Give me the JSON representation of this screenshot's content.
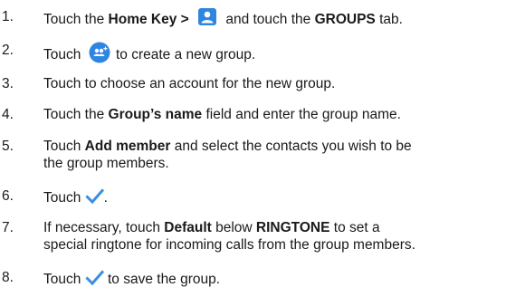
{
  "steps": [
    {
      "num": "1.",
      "t1": "Touch the ",
      "b1": "Home Key > ",
      "t2": " and touch the ",
      "b2": "GROUPS",
      "t3": " tab."
    },
    {
      "num": "2.",
      "t1": "Touch ",
      "t2": " to create a new group."
    },
    {
      "num": "3.",
      "t1": "Touch to choose an account for the new group."
    },
    {
      "num": "4.",
      "t1": "Touch the ",
      "b1": "Group’s name",
      "t2": " field and enter the group name."
    },
    {
      "num": "5.",
      "t1": "Touch ",
      "b1": "Add member",
      "t2": " and select the contacts you wish to be",
      "t3": "the group members."
    },
    {
      "num": "6.",
      "t1": "Touch ",
      "t2": "."
    },
    {
      "num": "7.",
      "t1": "If necessary, touch ",
      "b1": "Default",
      "t2": " below ",
      "b2": "RINGTONE",
      "t3": " to set a",
      "t4": "special ringtone for incoming calls from the group members."
    },
    {
      "num": "8.",
      "t1": "Touch ",
      "t2": " to save the group."
    }
  ],
  "icons": {
    "contacts": "contacts-app-icon",
    "new_group": "add-group-icon",
    "check": "checkmark-icon"
  },
  "colors": {
    "icon_blue": "#2f86e0",
    "check_blue": "#3b8fe3"
  }
}
